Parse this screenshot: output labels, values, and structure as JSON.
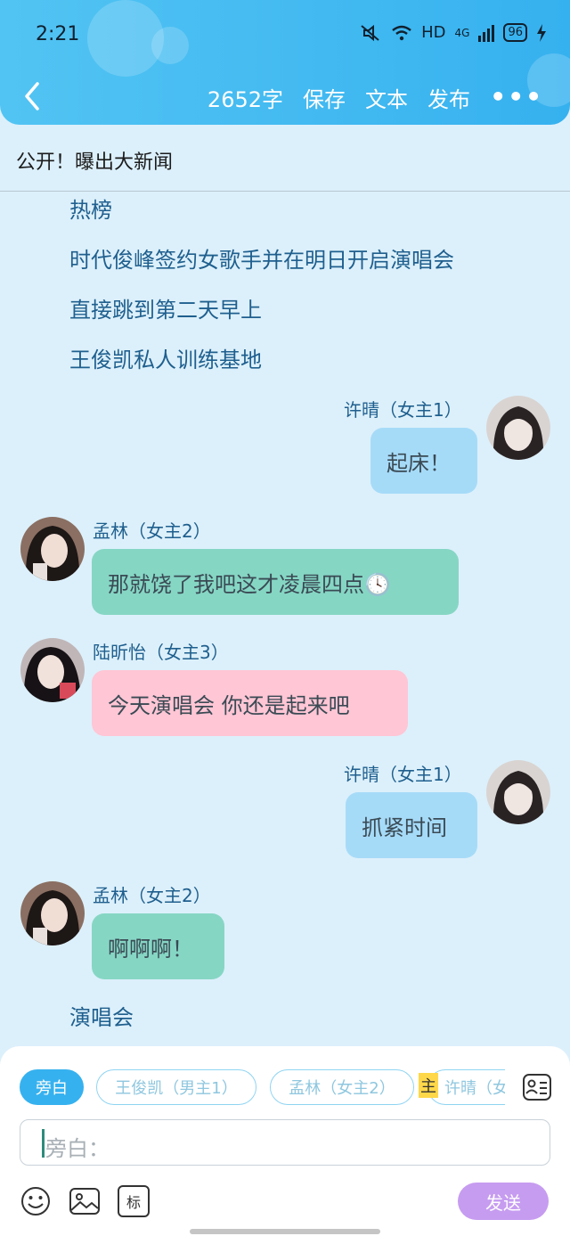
{
  "status_bar": {
    "time": "2:21",
    "network": "HD",
    "signal": "4G",
    "battery": "96"
  },
  "toolbar": {
    "word_count": "2652字",
    "save": "保存",
    "text": "文本",
    "publish": "发布",
    "more": "•••"
  },
  "story": {
    "title": "公开！曝出大新闻"
  },
  "narration": [
    "热榜",
    "时代俊峰签约女歌手并在明日开启演唱会",
    "直接跳到第二天早上",
    "王俊凯私人训练基地",
    "演唱会"
  ],
  "messages": [
    {
      "speaker": "许晴（女主1）",
      "text": "起床！",
      "side": "right",
      "color": "#a6dbf8"
    },
    {
      "speaker": "孟林（女主2）",
      "text": "那就饶了我吧这才凌晨四点🕓",
      "side": "left",
      "color": "#86d6c4"
    },
    {
      "speaker": "陆昕怡（女主3）",
      "text": "今天演唱会 你还是起来吧",
      "side": "left",
      "color": "#ffc6d5"
    },
    {
      "speaker": "许晴（女主1）",
      "text": "抓紧时间",
      "side": "right",
      "color": "#a6dbf8"
    },
    {
      "speaker": "孟林（女主2）",
      "text": "啊啊啊！",
      "side": "left",
      "color": "#86d6c4"
    }
  ],
  "composer": {
    "chips": [
      "旁白",
      "王俊凯（男主1）",
      "孟林（女主2）",
      "许晴（女"
    ],
    "role_tag": "主",
    "input_placeholder": "旁白：",
    "tag_button": "标",
    "send": "发送"
  },
  "colors": {
    "header": "#36b1ef",
    "background": "#dcf0fb",
    "accent": "#36b1ef",
    "send": "#c69cf0"
  }
}
